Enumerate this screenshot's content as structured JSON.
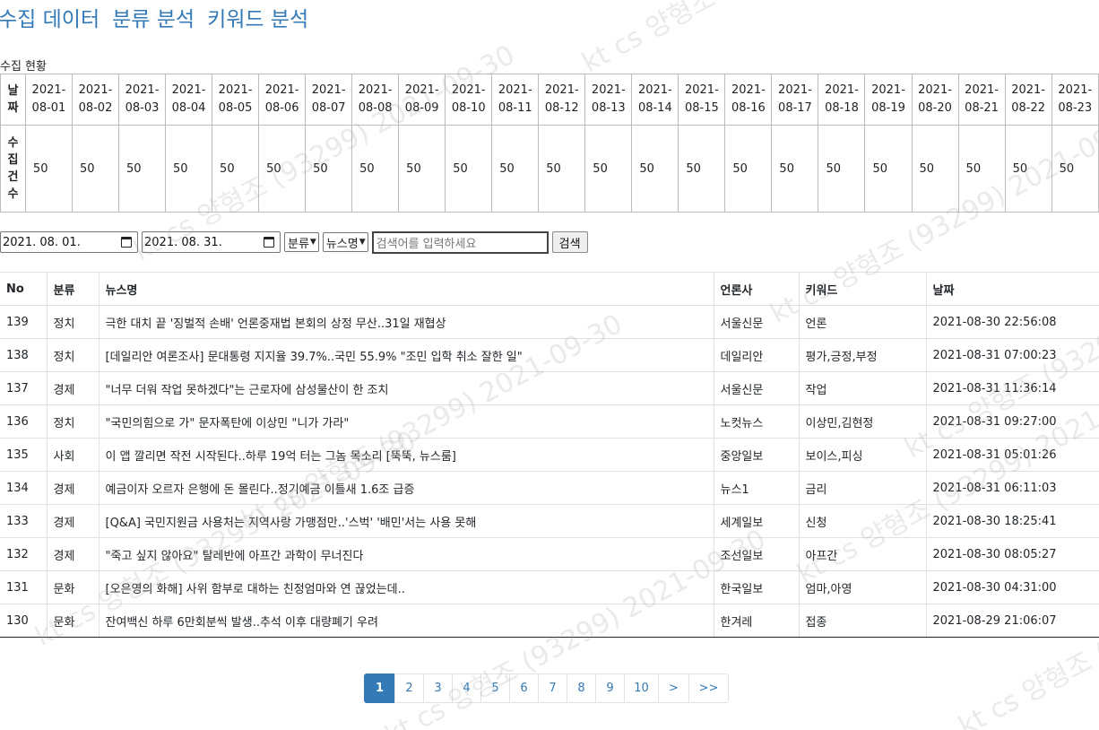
{
  "nav": {
    "items": [
      "수집 데이터",
      "분류 분석",
      "키워드 분석"
    ]
  },
  "collection": {
    "section_label": "수집 현황",
    "date_header": "날짜",
    "count_header": "수집건수",
    "dates": [
      "2021-08-01",
      "2021-08-02",
      "2021-08-03",
      "2021-08-04",
      "2021-08-05",
      "2021-08-06",
      "2021-08-07",
      "2021-08-08",
      "2021-08-09",
      "2021-08-10",
      "2021-08-11",
      "2021-08-12",
      "2021-08-13",
      "2021-08-14",
      "2021-08-15",
      "2021-08-16",
      "2021-08-17",
      "2021-08-18",
      "2021-08-19",
      "2021-08-20",
      "2021-08-21",
      "2021-08-22",
      "2021-08-23"
    ],
    "counts": [
      "50",
      "50",
      "50",
      "50",
      "50",
      "50",
      "50",
      "50",
      "50",
      "50",
      "50",
      "50",
      "50",
      "50",
      "50",
      "50",
      "50",
      "50",
      "50",
      "50",
      "50",
      "50",
      "50"
    ]
  },
  "filter": {
    "start_date": "2021. 08. 01.",
    "end_date": "2021. 08. 31.",
    "category_select": "분류",
    "news_select": "뉴스명",
    "search_placeholder": "검색어를 입력하세요",
    "search_button": "검색"
  },
  "news": {
    "headers": [
      "No",
      "분류",
      "뉴스명",
      "언론사",
      "키워드",
      "날짜"
    ],
    "rows": [
      [
        "139",
        "정치",
        "극한 대치 끝 '징벌적 손배' 언론중재법 본회의 상정 무산..31일 재협상",
        "서울신문",
        "언론",
        "2021-08-30 22:56:08"
      ],
      [
        "138",
        "정치",
        "[데일리안 여론조사] 문대통령 지지율 39.7%..국민 55.9% \"조민 입학 취소 잘한 일\"",
        "데일리안",
        "평가,긍정,부정",
        "2021-08-31 07:00:23"
      ],
      [
        "137",
        "경제",
        "\"너무 더워 작업 못하겠다\"는 근로자에 삼성물산이 한 조치",
        "서울신문",
        "작업",
        "2021-08-31 11:36:14"
      ],
      [
        "136",
        "정치",
        "\"국민의힘으로 가\" 문자폭탄에 이상민 \"니가 가라\"",
        "노컷뉴스",
        "이상민,김현정",
        "2021-08-31 09:27:00"
      ],
      [
        "135",
        "사회",
        "이 앱 깔리면 작전 시작된다..하루 19억 터는 그놈 목소리 [뚝뚝, 뉴스룸]",
        "중앙일보",
        "보이스,피싱",
        "2021-08-31 05:01:26"
      ],
      [
        "134",
        "경제",
        "예금이자 오르자 은행에 돈 몰린다..정기예금 이틀새 1.6조 급증",
        "뉴스1",
        "금리",
        "2021-08-31 06:11:03"
      ],
      [
        "133",
        "경제",
        "[Q&A] 국민지원금 사용처는 지역사랑 가맹점만..'스벅' '배민'서는 사용 못해",
        "세계일보",
        "신청",
        "2021-08-30 18:25:41"
      ],
      [
        "132",
        "경제",
        "\"죽고 싶지 않아요\" 탈레반에 아프간 과학이 무너진다",
        "조선일보",
        "아프간",
        "2021-08-30 08:05:27"
      ],
      [
        "131",
        "문화",
        "[오은영의 화해] 사위 함부로 대하는 친정엄마와 연 끊었는데..",
        "한국일보",
        "엄마,아영",
        "2021-08-30 04:31:00"
      ],
      [
        "130",
        "문화",
        "잔여백신 하루 6만회분씩 발생..추석 이후 대량폐기 우려",
        "한겨레",
        "접종",
        "2021-08-29 21:06:07"
      ]
    ]
  },
  "pagination": {
    "pages": [
      "1",
      "2",
      "3",
      "4",
      "5",
      "6",
      "7",
      "8",
      "9",
      "10"
    ],
    "active": "1",
    "next": ">",
    "last": ">>"
  },
  "watermark": {
    "text": "kt cs 양형조 (93299) 2021-09-30"
  },
  "colors": {
    "link": "#337ab7",
    "active_page_bg": "#337ab7",
    "border": "#dee2e6"
  }
}
